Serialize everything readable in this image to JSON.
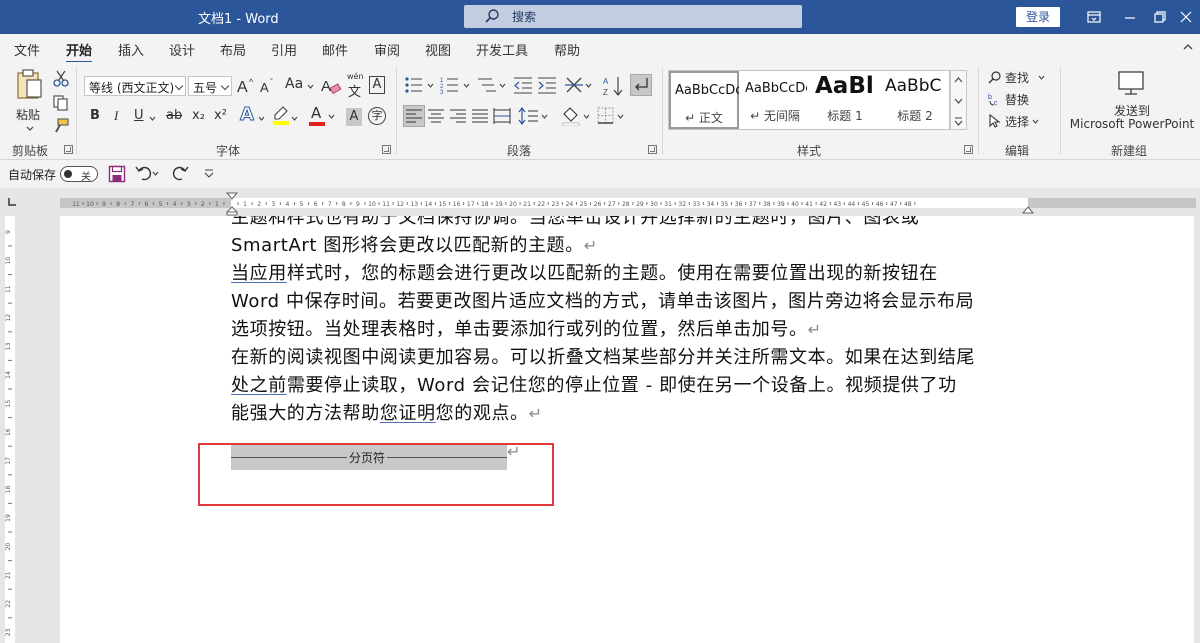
{
  "window": {
    "title": "文档1  -  Word",
    "search_placeholder": "搜索",
    "login_label": "登录"
  },
  "tabs": [
    "文件",
    "开始",
    "插入",
    "设计",
    "布局",
    "引用",
    "邮件",
    "审阅",
    "视图",
    "开发工具",
    "帮助"
  ],
  "active_tab": "开始",
  "ribbon": {
    "clipboard": {
      "paste_label": "粘贴",
      "group_label": "剪贴板"
    },
    "font": {
      "font_name": "等线 (西文正文)",
      "font_size": "五号",
      "aa_label": "Aa",
      "phonetic_top": "wén",
      "phonetic_glyph": "文",
      "boxed_glyph": "A",
      "char_shading_glyph": "A",
      "enclose_glyph": "字",
      "bold": "B",
      "italic": "I",
      "underline": "U",
      "strike": "ab",
      "sub": "x₂",
      "sup": "x²",
      "effects_glyph": "A",
      "color_glyph": "A",
      "group_label": "字体"
    },
    "paragraph": {
      "group_label": "段落"
    },
    "styles": {
      "items": [
        {
          "sample": "AaBbCcDc",
          "name": "↵ 正文"
        },
        {
          "sample": "AaBbCcDc",
          "name": "↵ 无间隔"
        },
        {
          "sample": "AaBl",
          "name": "标题 1"
        },
        {
          "sample": "AaBbC",
          "name": "标题 2"
        }
      ],
      "group_label": "样式"
    },
    "editing": {
      "find": "查找",
      "replace": "替换",
      "select": "选择",
      "group_label": "编辑"
    },
    "new_group": {
      "send_line1": "发送到",
      "send_line2": "Microsoft PowerPoint",
      "group_label": "新建组"
    }
  },
  "qat": {
    "autosave_label": "自动保存",
    "toggle_state": "关"
  },
  "document": {
    "lines": [
      [
        "主题和样式也有助于文档保持协调。当您单击设计并选择新的主题时，图片、图表或"
      ],
      [
        "SmartArt 图形将会更改以匹配新的主题。"
      ],
      [
        "当应用",
        "样式时，您的标题会进行更改以匹配新的主题。使用在需要位置出现的新按钮在"
      ],
      [
        "Word 中保存时间。若要更改图片适应文档的方式，请单击该图片，图片旁边将会显示布局"
      ],
      [
        "选项按钮。当处理表格时，单击要添加行或列的位置，然后单击加号。"
      ],
      [
        "在新的阅读视图中阅读更加容易。可以折叠文档某些部分并关注所需文本。如果在达到结尾"
      ],
      [
        "处之前",
        "需要停止读取，Word 会记住您的停止位置 - 即使在另一个设备上。视频提供了功"
      ],
      [
        "能强大的方法帮助",
        "您证明",
        "您的观点。"
      ]
    ],
    "page_break_label": "分页符",
    "para_mark": "↵"
  }
}
